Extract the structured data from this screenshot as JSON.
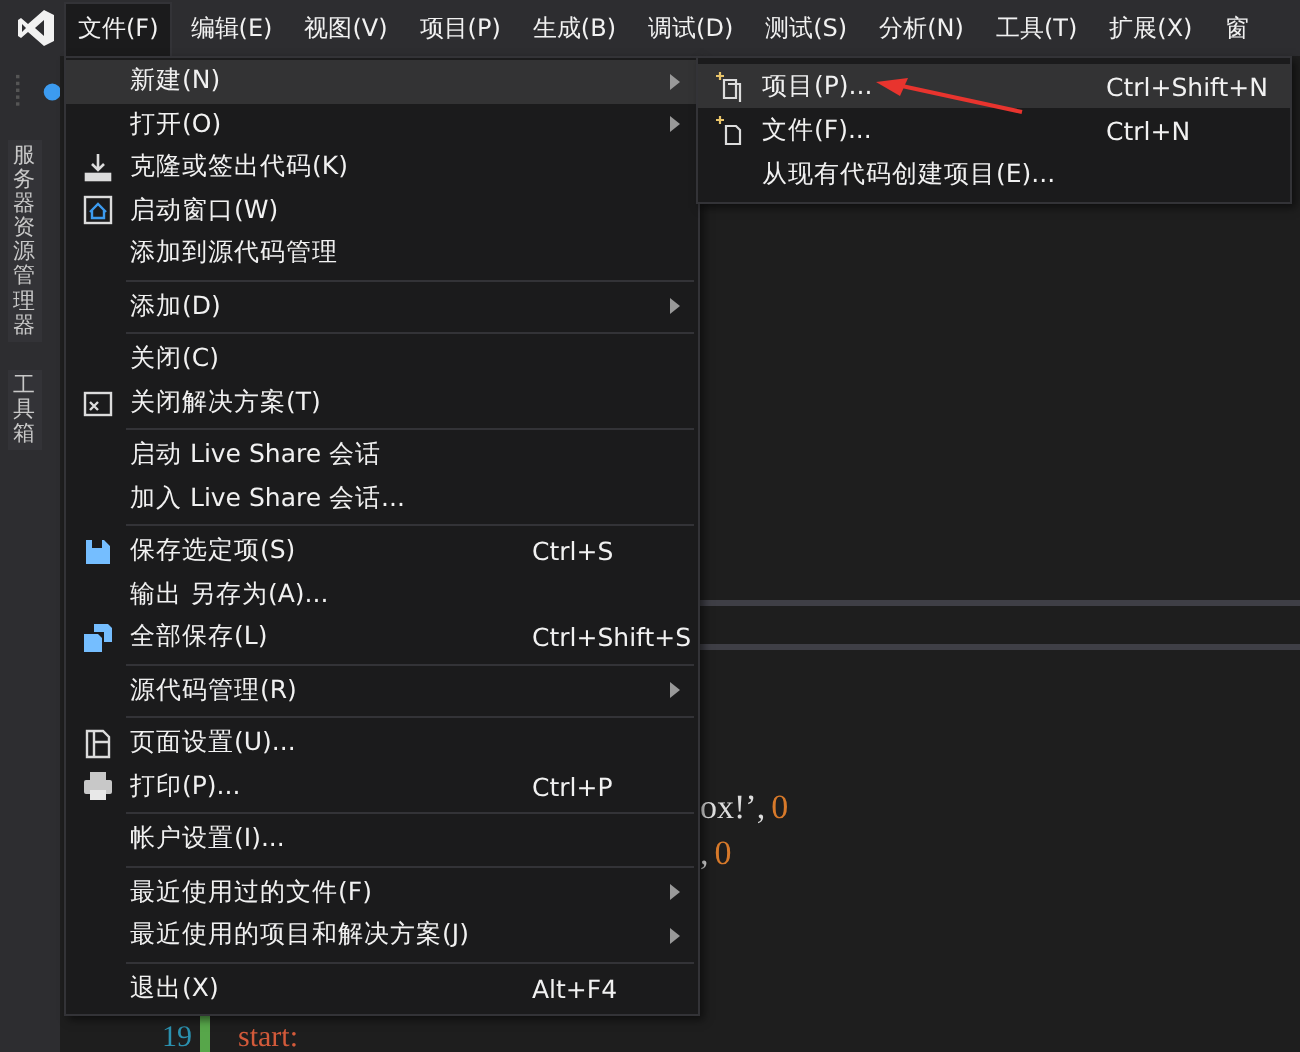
{
  "menubar": {
    "items": [
      {
        "label": "文件(F)",
        "selected": true
      },
      {
        "label": "编辑(E)",
        "selected": false
      },
      {
        "label": "视图(V)",
        "selected": false
      },
      {
        "label": "项目(P)",
        "selected": false
      },
      {
        "label": "生成(B)",
        "selected": false
      },
      {
        "label": "调试(D)",
        "selected": false
      },
      {
        "label": "测试(S)",
        "selected": false
      },
      {
        "label": "分析(N)",
        "selected": false
      },
      {
        "label": "工具(T)",
        "selected": false
      },
      {
        "label": "扩展(X)",
        "selected": false
      },
      {
        "label": "窗",
        "selected": false
      }
    ]
  },
  "side_tabs": [
    "服务器资源管理器",
    "工具箱"
  ],
  "editor": {
    "lines": [
      {
        "kind": "fragment",
        "text": "ox!’,",
        "value": "0"
      },
      {
        "kind": "fragment",
        "text": ",",
        "value": "0"
      },
      {
        "kind": "numbered",
        "number": "19",
        "text": "start:"
      }
    ]
  },
  "file_menu": {
    "items": [
      {
        "kind": "item",
        "label": "新建(N)",
        "submenu": true,
        "selected": true
      },
      {
        "kind": "item",
        "label": "打开(O)",
        "submenu": true,
        "selected": false
      },
      {
        "kind": "item",
        "label": "克隆或签出代码(K)",
        "submenu": false,
        "selected": false
      },
      {
        "kind": "item",
        "label": "启动窗口(W)",
        "submenu": false,
        "selected": false
      },
      {
        "kind": "item",
        "label": "添加到源代码管理",
        "submenu": false,
        "selected": false
      },
      {
        "kind": "separator"
      },
      {
        "kind": "item",
        "label": "添加(D)",
        "submenu": true,
        "selected": false
      },
      {
        "kind": "separator"
      },
      {
        "kind": "item",
        "label": "关闭(C)",
        "submenu": false,
        "selected": false
      },
      {
        "kind": "item",
        "label": "关闭解决方案(T)",
        "submenu": false,
        "selected": false
      },
      {
        "kind": "separator"
      },
      {
        "kind": "item",
        "label": "启动 Live Share 会话",
        "submenu": false,
        "selected": false
      },
      {
        "kind": "item",
        "label": "加入 Live Share 会话...",
        "submenu": false,
        "selected": false
      },
      {
        "kind": "separator"
      },
      {
        "kind": "item",
        "label": "保存选定项(S)",
        "shortcut": "Ctrl+S",
        "submenu": false,
        "selected": false
      },
      {
        "kind": "item",
        "label": "输出 另存为(A)...",
        "submenu": false,
        "selected": false
      },
      {
        "kind": "item",
        "label": "全部保存(L)",
        "shortcut": "Ctrl+Shift+S",
        "submenu": false,
        "selected": false
      },
      {
        "kind": "separator"
      },
      {
        "kind": "item",
        "label": "源代码管理(R)",
        "submenu": true,
        "selected": false
      },
      {
        "kind": "separator"
      },
      {
        "kind": "item",
        "label": "页面设置(U)...",
        "submenu": false,
        "selected": false
      },
      {
        "kind": "item",
        "label": "打印(P)...",
        "shortcut": "Ctrl+P",
        "submenu": false,
        "selected": false
      },
      {
        "kind": "separator"
      },
      {
        "kind": "item",
        "label": "帐户设置(I)...",
        "submenu": false,
        "selected": false
      },
      {
        "kind": "separator"
      },
      {
        "kind": "item",
        "label": "最近使用过的文件(F)",
        "submenu": true,
        "selected": false
      },
      {
        "kind": "item",
        "label": "最近使用的项目和解决方案(J)",
        "submenu": true,
        "selected": false
      },
      {
        "kind": "separator"
      },
      {
        "kind": "item",
        "label": "退出(X)",
        "shortcut": "Alt+F4",
        "submenu": false,
        "selected": false
      }
    ]
  },
  "new_submenu": {
    "items": [
      {
        "label": "项目(P)...",
        "shortcut": "Ctrl+Shift+N",
        "selected": true
      },
      {
        "label": "文件(F)...",
        "shortcut": "Ctrl+N",
        "selected": false
      },
      {
        "label": "从现有代码创建项目(E)...",
        "selected": false
      }
    ]
  }
}
